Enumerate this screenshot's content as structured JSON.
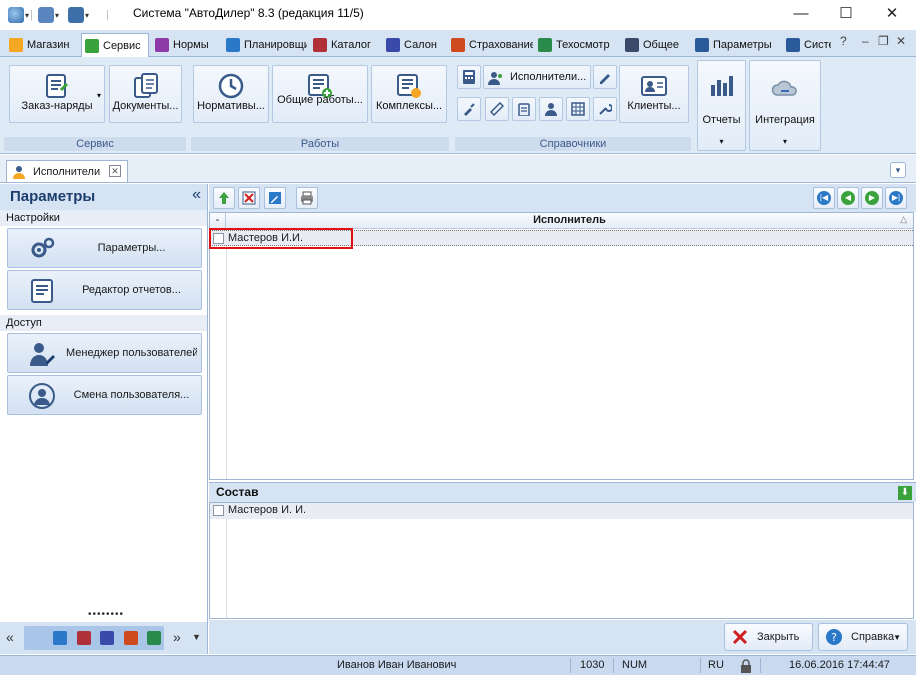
{
  "window": {
    "title": "Система \"АвтоДилер\" 8.3 (редакция 11/5)",
    "min": "—",
    "max": "☐",
    "close": "✕"
  },
  "ribbon_tabs": [
    {
      "label": "Магазин",
      "color": "#f5a623"
    },
    {
      "label": "Сервис",
      "color": "#3aa23a"
    },
    {
      "label": "Нормы",
      "color": "#8b3aa8"
    },
    {
      "label": "Планировщик",
      "color": "#2a78c8"
    },
    {
      "label": "Каталог",
      "color": "#b0303a"
    },
    {
      "label": "Салон",
      "color": "#3a4aa8"
    },
    {
      "label": "Страхование",
      "color": "#d04a20"
    },
    {
      "label": "Техосмотр",
      "color": "#2a8a4a"
    },
    {
      "label": "Общее",
      "color": "#3a4a6a"
    },
    {
      "label": "Параметры",
      "color": "#2a5a9a"
    },
    {
      "label": "Система",
      "color": "#2a5a9a"
    }
  ],
  "ribbon_controls": {
    "help": "?",
    "minimize": "–",
    "restore": "❐",
    "close": "✕"
  },
  "ribbon": {
    "service_group": {
      "label": "Сервис",
      "orders": "Заказ-наряды",
      "documents": "Документы..."
    },
    "works_group": {
      "label": "Работы",
      "norms": "Нормативы...",
      "common_works": "Общие работы...",
      "complexes": "Комплексы..."
    },
    "directories_group": {
      "label": "Справочники",
      "executors": "Исполнители...",
      "clients": "Клиенты..."
    },
    "reports": "Отчеты",
    "integration": "Интеграция"
  },
  "doc_tab": {
    "label": "Исполнители",
    "close": "✕"
  },
  "left_panel": {
    "title": "Параметры",
    "collapse": "«",
    "section_settings": "Настройки",
    "btn_parameters": "Параметры...",
    "btn_report_editor": "Редактор отчетов...",
    "section_access": "Доступ",
    "btn_user_manager": "Менеджер пользователей...",
    "btn_change_user": "Смена пользователя...",
    "dots": "••••••••",
    "bottom_left_arrow": "«",
    "bottom_right_arrow": "»",
    "bottom_dropdown": "▼"
  },
  "grid": {
    "minus": "-",
    "column": "Исполнитель",
    "sort_marker": "△",
    "rows": [
      "Мастеров И.И."
    ]
  },
  "composition": {
    "title": "Состав",
    "download": "⬇",
    "rows": [
      "Мастеров И. И."
    ]
  },
  "actions": {
    "close": "Закрыть",
    "help": "Справка",
    "help_dropdown": "▼"
  },
  "status": {
    "user": "Иванов Иван Иванович",
    "code": "1030",
    "num": "NUM",
    "lang": "RU",
    "datetime": "16.06.2016 17:44:47"
  }
}
